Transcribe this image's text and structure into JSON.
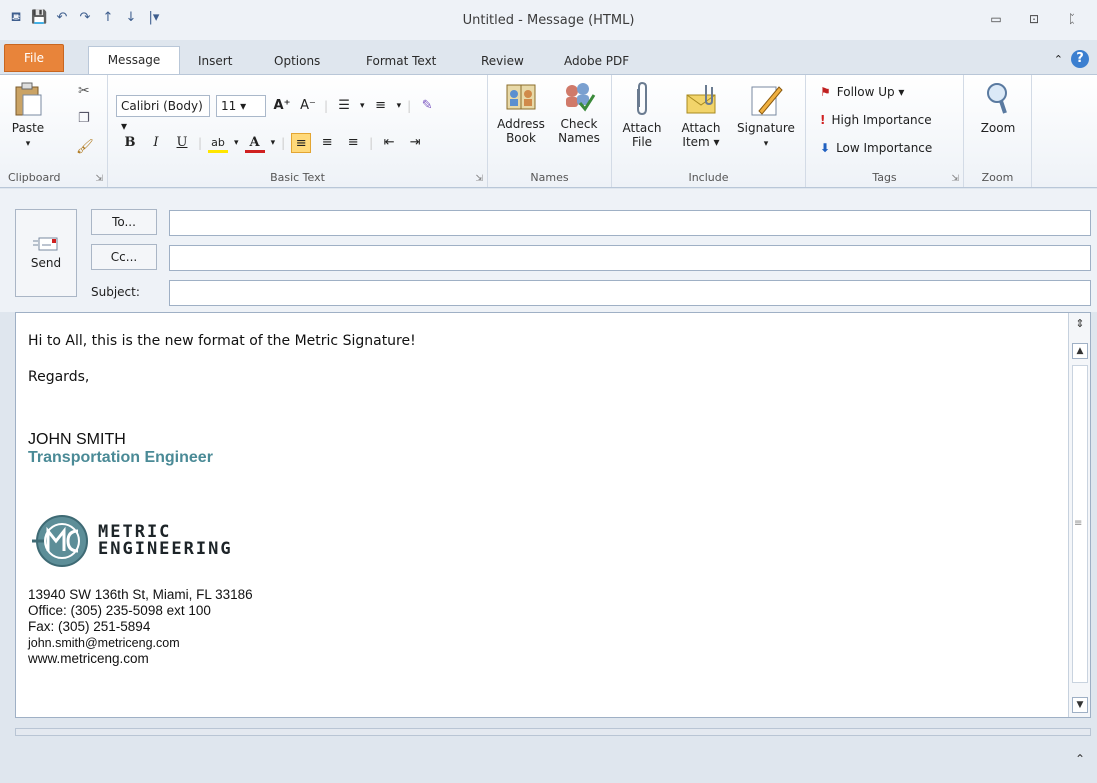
{
  "window": {
    "title": "Untitled - Message (HTML)",
    "minimize": "▭",
    "restore": "⊡",
    "close": "ᛈ"
  },
  "qat": {
    "save": "💾",
    "undo": "↶",
    "redo": "↷",
    "up": "↑",
    "down": "↓",
    "more": "|▾"
  },
  "tabs": [
    "File",
    "Message",
    "Insert",
    "Options",
    "Format Text",
    "Review",
    "Adobe PDF"
  ],
  "ribbon": {
    "clipboard": {
      "paste": "Paste",
      "label": "Clipboard"
    },
    "basic_text": {
      "font": "Calibri (Body)",
      "size": "11",
      "label": "Basic Text"
    },
    "names": {
      "address_book": [
        "Address",
        "Book"
      ],
      "check_names": [
        "Check",
        "Names"
      ],
      "label": "Names"
    },
    "include": {
      "attach_file": [
        "Attach",
        "File"
      ],
      "attach_item": [
        "Attach",
        "Item ▾"
      ],
      "signature": "Signature",
      "label": "Include"
    },
    "tags": {
      "follow_up": "Follow Up ▾",
      "high": "High Importance",
      "low": "Low Importance",
      "label": "Tags"
    },
    "zoom": {
      "zoom": "Zoom",
      "label": "Zoom"
    }
  },
  "header": {
    "send": "Send",
    "to": "To...",
    "cc": "Cc...",
    "subject": "Subject:",
    "to_value": "",
    "cc_value": "",
    "subject_value": ""
  },
  "body": {
    "greeting": "Hi to All, this is the new format of the Metric Signature!",
    "regards": "Regards,",
    "name": "JOHN SMITH",
    "role": "Transportation Engineer",
    "logo_line1": "METRIC",
    "logo_line2": "ENGINEERING",
    "address": "13940 SW 136th St, Miami, FL 33186",
    "office": "Office: (305) 235-5098 ext 100",
    "fax": "Fax: (305) 251-5894",
    "email": "john.smith@metriceng.com",
    "web": "www.metriceng.com"
  },
  "colors": {
    "accent_file_tab": "#e8843a",
    "role_teal": "#4a8a96",
    "ribbon_bg": "#eef2f7"
  }
}
